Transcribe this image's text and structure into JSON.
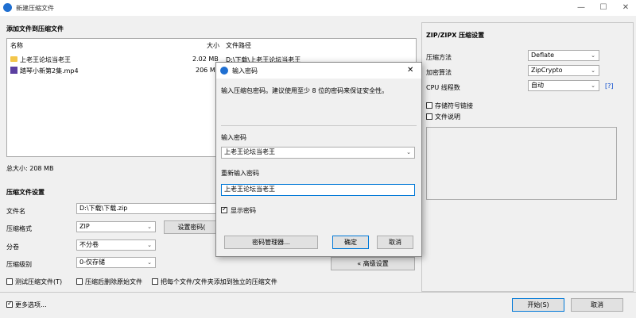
{
  "window": {
    "title": "新建压缩文件",
    "minimize": "—",
    "maximize": "☐",
    "close": "✕"
  },
  "files": {
    "section_title": "添加文件到压缩文件",
    "headers": {
      "name": "名称",
      "size": "大小",
      "path": "文件路径"
    },
    "rows": [
      {
        "name": "上老王论坛当老王",
        "size": "2.02 MB",
        "path": "D:\\下载\\上老王论坛当老王",
        "icon": "folder-icon"
      },
      {
        "name": "踏琴小新第2集.mp4",
        "size": "206 M",
        "path": "",
        "icon": "video-file-icon"
      }
    ],
    "total": "总大小: 208 MB"
  },
  "compress": {
    "section_title": "压缩文件设置",
    "filename_label": "文件名",
    "filename_value": "D:\\下载\\下载.zip",
    "format_label": "压缩格式",
    "format_value": "ZIP",
    "set_password_button": "设置密码(",
    "split_label": "分卷",
    "split_value": "不分卷",
    "level_label": "压缩级别",
    "level_value": "0-仅存储",
    "advanced_button": "« 高级设置",
    "opt_test": "测试压缩文件(T)",
    "opt_delete": "压缩后删除原始文件",
    "opt_separate": "把每个文件/文件夹添加到独立的压缩文件"
  },
  "footer": {
    "more_options": "更多选项...",
    "start_button": "开始(S)",
    "cancel_button": "取消"
  },
  "right_panel": {
    "title": "ZIP/ZIPX 压缩设置",
    "method_label": "压缩方法",
    "method_value": "Deflate",
    "encrypt_label": "加密算法",
    "encrypt_value": "ZipCrypto",
    "threads_label": "CPU 线程数",
    "threads_value": "自动",
    "help_link": "[?]",
    "store_symlinks": "存储符号链接",
    "file_comment": "文件说明"
  },
  "dialog": {
    "title": "输入密码",
    "close": "✕",
    "description": "输入压缩包密码。建议使用至少 8 位的密码来保证安全性。",
    "password_label": "输入密码",
    "password_value": "上老王论坛当老王",
    "confirm_label": "重新输入密码",
    "confirm_value": "上老王论坛当老王",
    "show_password": "显示密码",
    "manager_button": "密码管理器...",
    "ok_button": "确定",
    "cancel_button": "取消"
  },
  "colors": {
    "accent": "#0078d7",
    "app_icon": "#1f6fd1",
    "folder": "#f3c64b",
    "link": "#0044cc"
  }
}
